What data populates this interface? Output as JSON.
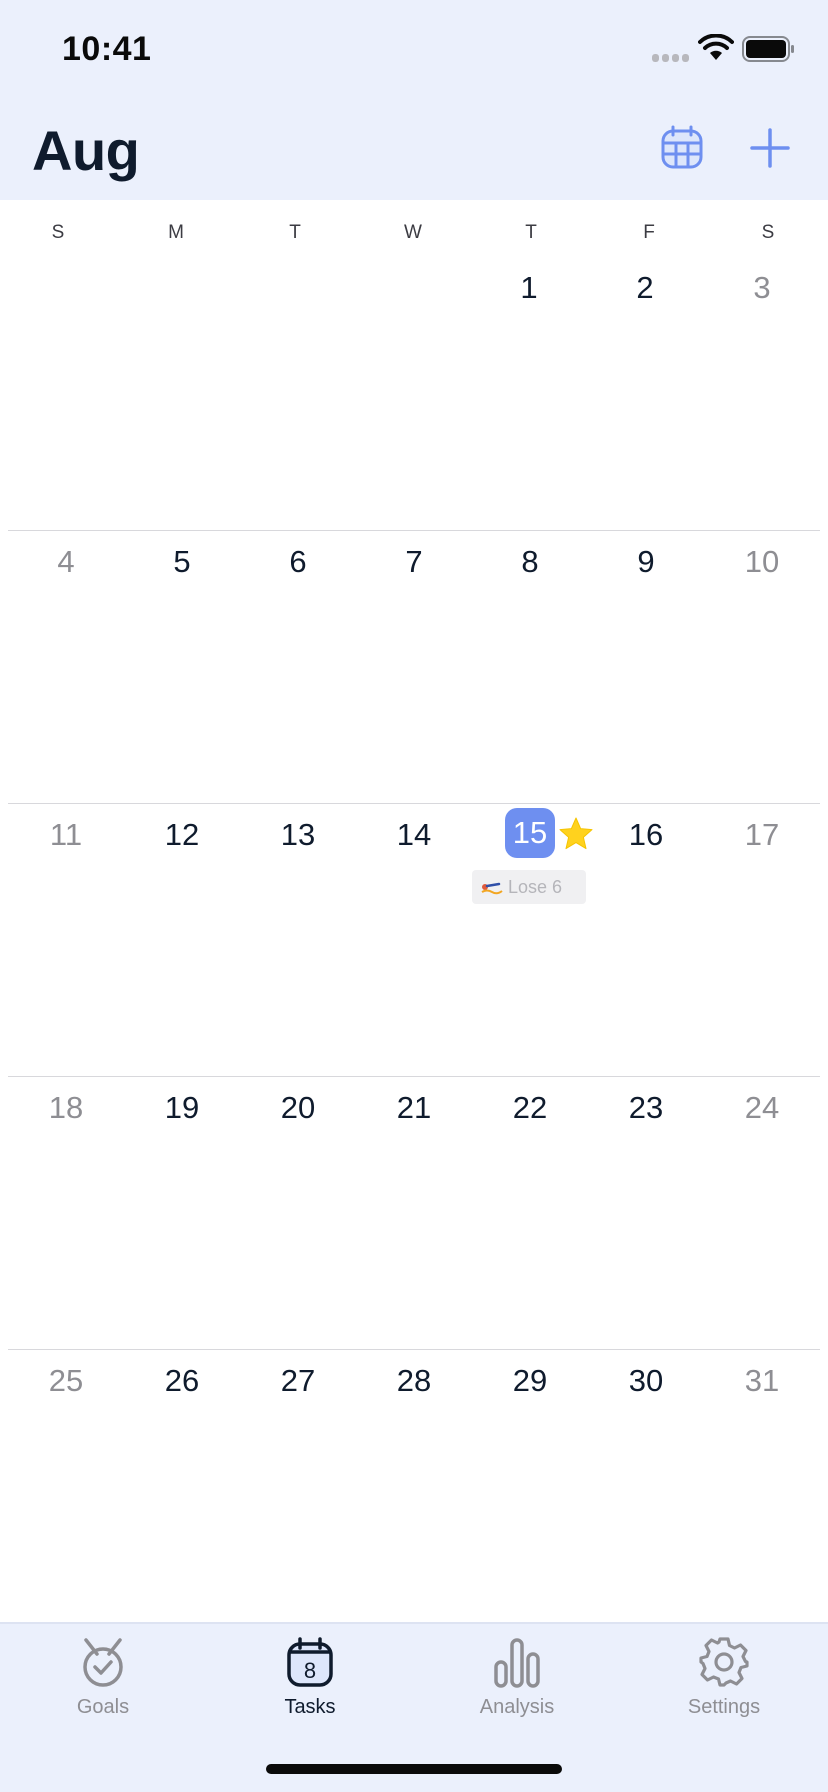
{
  "status_bar": {
    "time": "10:41"
  },
  "header": {
    "month": "Aug"
  },
  "colors": {
    "accent": "#6e8ff0",
    "header_bg": "#ebf0fc",
    "star": "#ffd21e"
  },
  "weekdays": [
    "S",
    "M",
    "T",
    "W",
    "T",
    "F",
    "S"
  ],
  "weeks": [
    [
      "",
      "",
      "",
      "",
      "1",
      "2",
      "3"
    ],
    [
      "4",
      "5",
      "6",
      "7",
      "8",
      "9",
      "10"
    ],
    [
      "11",
      "12",
      "13",
      "14",
      "15",
      "16",
      "17"
    ],
    [
      "18",
      "19",
      "20",
      "21",
      "22",
      "23",
      "24"
    ],
    [
      "25",
      "26",
      "27",
      "28",
      "29",
      "30",
      "31"
    ]
  ],
  "today": "15",
  "today_task": {
    "label": "Lose 6",
    "icon": "swimmer-icon"
  },
  "tabs": [
    {
      "label": "Goals",
      "icon": "medal-icon"
    },
    {
      "label": "Tasks",
      "icon": "calendar-badge-icon",
      "badge": "8"
    },
    {
      "label": "Analysis",
      "icon": "bar-chart-icon"
    },
    {
      "label": "Settings",
      "icon": "gear-icon"
    }
  ],
  "active_tab": "Tasks"
}
